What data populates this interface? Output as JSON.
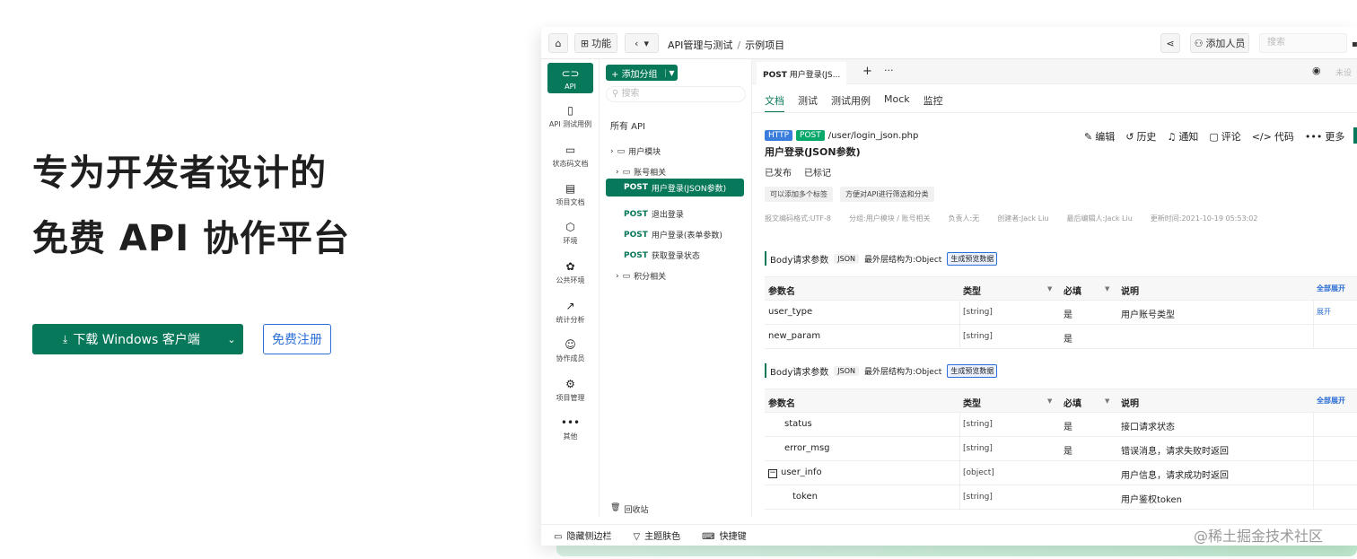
{
  "hero": {
    "line1": "专为开发者设计的",
    "line2": "免费 API 协作平台",
    "download_label": "下载 Windows 客户端",
    "register_label": "免费注册"
  },
  "topbar": {
    "func_label": "功能",
    "breadcrumb": [
      "API管理与测试",
      "示例项目"
    ],
    "add_member_label": "添加人员",
    "search_placeholder": "搜索"
  },
  "leftnav": [
    {
      "label": "API",
      "icon": "link-icon"
    },
    {
      "label": "API 测试用例",
      "icon": "clipboard-icon"
    },
    {
      "label": "状态码文档",
      "icon": "document-icon"
    },
    {
      "label": "项目文档",
      "icon": "list-icon"
    },
    {
      "label": "环境",
      "icon": "cube-icon"
    },
    {
      "label": "公共环境",
      "icon": "puzzle-icon"
    },
    {
      "label": "统计分析",
      "icon": "chart-icon"
    },
    {
      "label": "协作成员",
      "icon": "users-icon"
    },
    {
      "label": "项目管理",
      "icon": "settings-icon"
    },
    {
      "label": "其他",
      "icon": "more-icon"
    }
  ],
  "tree": {
    "add_group_label": "添加分组",
    "search_placeholder": "搜索",
    "all_api": "所有 API",
    "items": [
      {
        "type": "folder",
        "label": "用户模块"
      },
      {
        "type": "folder",
        "label": "账号相关"
      },
      {
        "type": "api",
        "method": "POST",
        "label": "用户登录(JSON参数)"
      },
      {
        "type": "api",
        "method": "POST",
        "label": "退出登录"
      },
      {
        "type": "api",
        "method": "POST",
        "label": "用户登录(表单参数)"
      },
      {
        "type": "api",
        "method": "POST",
        "label": "获取登录状态"
      },
      {
        "type": "folder",
        "label": "积分相关"
      }
    ],
    "recycle_label": "回收站"
  },
  "main": {
    "tab_method": "POST",
    "tab_title": "用户登录(JS...",
    "tab_edge": "未设",
    "subtabs": [
      "文档",
      "测试",
      "测试用例",
      "Mock",
      "监控"
    ],
    "protocol": "HTTP",
    "method": "POST",
    "path": "/user/login_json.php",
    "api_name": "用户登录(JSON参数)",
    "actions": [
      "编辑",
      "历史",
      "通知",
      "评论",
      "代码",
      "更多"
    ],
    "status": [
      "已发布",
      "已标记"
    ],
    "tags": [
      "可以添加多个标签",
      "方便对API进行筛选和分类"
    ],
    "meta": [
      "报文编码格式:UTF-8",
      "分组:用户模块 / 账号相关",
      "负责人:无",
      "创建者:Jack Liu",
      "最后编辑人:Jack Liu",
      "更新时间:2021-10-19 05:53:02"
    ]
  },
  "body_section": {
    "title": "Body请求参数",
    "json": "JSON",
    "outer": "最外层结构为:Object",
    "gen": "生成预览数据",
    "headers": [
      "参数名",
      "类型",
      "必填",
      "说明"
    ],
    "expand_all": "全部展开",
    "rows": [
      {
        "name": "user_type",
        "type": "[string]",
        "required": "是",
        "desc": "用户账号类型",
        "extra": "展开"
      },
      {
        "name": "new_param",
        "type": "[string]",
        "required": "是",
        "desc": "",
        "extra": ""
      }
    ]
  },
  "resp_section": {
    "title": "Body请求参数",
    "json": "JSON",
    "outer": "最外层结构为:Object",
    "gen": "生成预览数据",
    "headers": [
      "参数名",
      "类型",
      "必填",
      "说明"
    ],
    "expand_all": "全部展开",
    "rows": [
      {
        "name": "status",
        "type": "[string]",
        "required": "是",
        "desc": "接口请求状态"
      },
      {
        "name": "error_msg",
        "type": "[string]",
        "required": "是",
        "desc": "错误消息，请求失败时返回"
      },
      {
        "name": "user_info",
        "type": "[object]",
        "required": "",
        "desc": "用户信息，请求成功时返回"
      },
      {
        "name": "token",
        "type": "[string]",
        "required": "",
        "desc": "用户鉴权token"
      }
    ]
  },
  "bottombar": [
    "隐藏侧边栏",
    "主题肤色",
    "快捷键"
  ],
  "watermark": "@稀土掘金技术社区",
  "colors": {
    "brand": "#08785a",
    "link": "#2d6fd6"
  }
}
